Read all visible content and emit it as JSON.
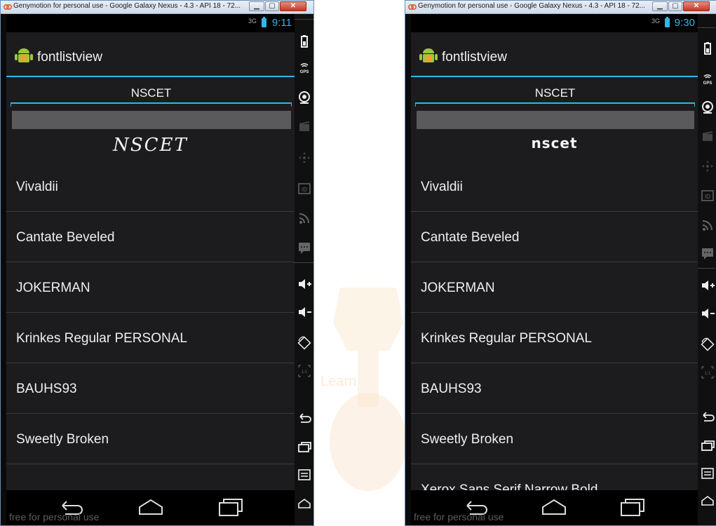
{
  "windows": [
    {
      "title": "Genymotion for personal use - Google Galaxy Nexus - 4.3 - API 18 - 72...",
      "status_time": "9:11",
      "network_label": "3G",
      "app_title": "fontlistview",
      "edit_text": "NSCET",
      "preview_text": "NSCET",
      "list_items": [
        "Vivaldii",
        "Cantate Beveled",
        "JOKERMAN",
        "Krinkes Regular PERSONAL",
        "BAUHS93",
        "Sweetly Broken",
        ""
      ],
      "watermark": "free for personal use"
    },
    {
      "title": "Genymotion for personal use - Google Galaxy Nexus - 4.3 - API 18 - 72...",
      "status_time": "9:30",
      "network_label": "3G",
      "app_title": "fontlistview",
      "edit_text": "NSCET",
      "preview_text": "nscet",
      "list_items": [
        "Vivaldii",
        "Cantate Beveled",
        "JOKERMAN",
        "Krinkes Regular PERSONAL",
        "BAUHS93",
        "Sweetly Broken",
        "Xerox Sans Serif Narrow Bold"
      ],
      "watermark": "free for personal use"
    }
  ],
  "side_panel_icons": [
    "battery-icon",
    "gps-icon",
    "camera-icon",
    "video-icon",
    "dpad-icon",
    "id-icon",
    "rss-icon",
    "sms-icon",
    "volume-up-icon",
    "volume-down-icon",
    "rotate-icon",
    "scale-icon",
    "back-icon",
    "recent-apps-icon",
    "menu-icon",
    "home-icon"
  ],
  "colors": {
    "accent": "#33b5e5",
    "screen_bg": "#1c1c1e"
  }
}
